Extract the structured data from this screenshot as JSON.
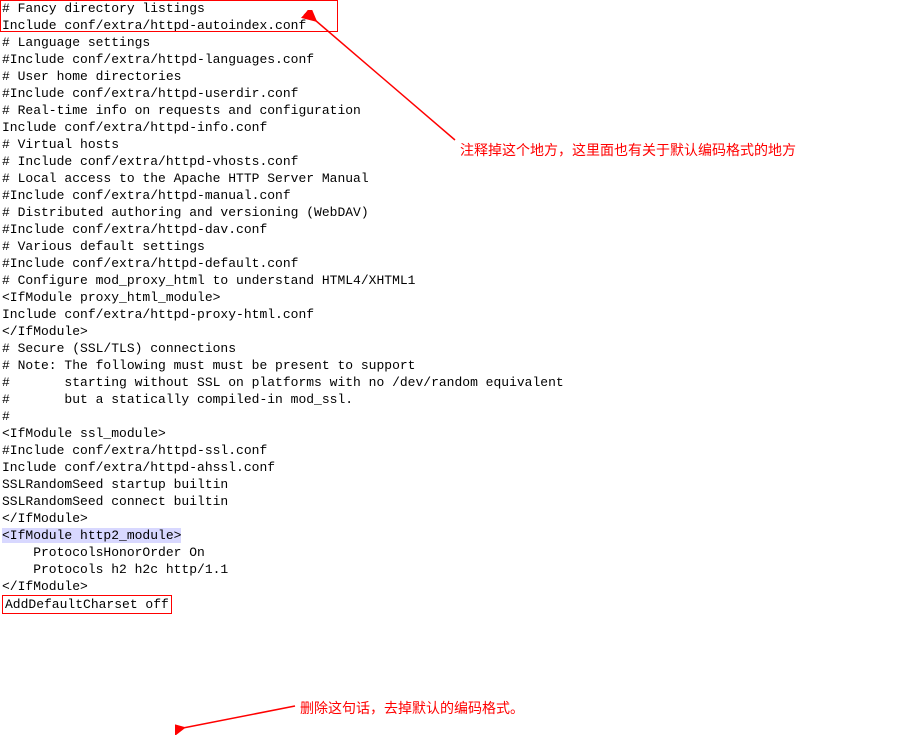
{
  "annotations": {
    "top": "注释掉这个地方，这里面也有关于默认编码格式的地方",
    "bottom": "删除这句话，去掉默认的编码格式。"
  },
  "code": {
    "l01": "# Fancy directory listings",
    "l02": "Include conf/extra/httpd-autoindex.conf",
    "l03": "",
    "l04": "# Language settings",
    "l05": "#Include conf/extra/httpd-languages.conf",
    "l06": "",
    "l07": "# User home directories",
    "l08": "#Include conf/extra/httpd-userdir.conf",
    "l09": "",
    "l10": "# Real-time info on requests and configuration",
    "l11": "Include conf/extra/httpd-info.conf",
    "l12": "",
    "l13": "# Virtual hosts",
    "l14": "# Include conf/extra/httpd-vhosts.conf",
    "l15": "",
    "l16": "# Local access to the Apache HTTP Server Manual",
    "l17": "#Include conf/extra/httpd-manual.conf",
    "l18": "",
    "l19": "# Distributed authoring and versioning (WebDAV)",
    "l20": "#Include conf/extra/httpd-dav.conf",
    "l21": "",
    "l22": "# Various default settings",
    "l23": "#Include conf/extra/httpd-default.conf",
    "l24": "",
    "l25": "# Configure mod_proxy_html to understand HTML4/XHTML1",
    "l26": "<IfModule proxy_html_module>",
    "l27": "Include conf/extra/httpd-proxy-html.conf",
    "l28": "</IfModule>",
    "l29": "",
    "l30": "# Secure (SSL/TLS) connections",
    "l31": "# Note: The following must must be present to support",
    "l32": "#       starting without SSL on platforms with no /dev/random equivalent",
    "l33": "#       but a statically compiled-in mod_ssl.",
    "l34": "#",
    "l35": "<IfModule ssl_module>",
    "l36": "#Include conf/extra/httpd-ssl.conf",
    "l37": "Include conf/extra/httpd-ahssl.conf",
    "l38": "SSLRandomSeed startup builtin",
    "l39": "SSLRandomSeed connect builtin",
    "l40": "</IfModule>",
    "l41": "<IfModule http2_module>",
    "l42": "    ProtocolsHonorOrder On",
    "l43": "    Protocols h2 h2c http/1.1",
    "l44": "</IfModule>",
    "l45": "",
    "l46": "AddDefaultCharset off"
  }
}
